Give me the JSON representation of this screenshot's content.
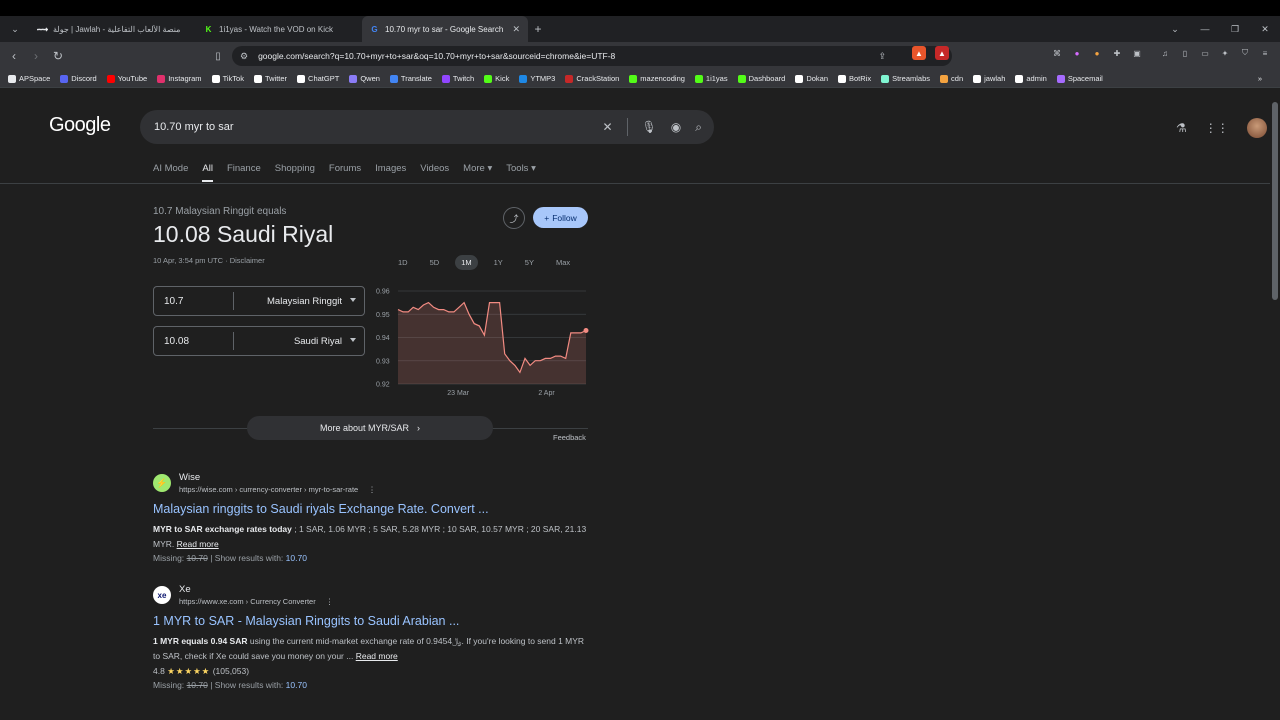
{
  "browser": {
    "tabs": [
      {
        "title": "جولة | Jawlah - منصة الألعاب التفاعلية",
        "icon": "jawlah-icon"
      },
      {
        "title": "1i1yas - Watch the VOD on Kick",
        "icon": "kick-icon"
      },
      {
        "title": "10.70 myr to sar - Google Search",
        "icon": "google-icon",
        "active": true
      }
    ],
    "url": "google.com/search?q=10.70+myr+to+sar&oq=10.70+myr+to+sar&sourceid=chrome&ie=UTF-8",
    "bookmarks": [
      {
        "label": "APSpace",
        "color": "#e8eaed"
      },
      {
        "label": "Discord",
        "color": "#5865f2"
      },
      {
        "label": "YouTube",
        "color": "#ff0000"
      },
      {
        "label": "Instagram",
        "color": "#e1306c"
      },
      {
        "label": "TikTok",
        "color": "#ffffff"
      },
      {
        "label": "Twitter",
        "color": "#ffffff"
      },
      {
        "label": "ChatGPT",
        "color": "#ffffff"
      },
      {
        "label": "Qwen",
        "color": "#8b7cf6"
      },
      {
        "label": "Translate",
        "color": "#4285f4"
      },
      {
        "label": "Twitch",
        "color": "#9146ff"
      },
      {
        "label": "Kick",
        "color": "#53fc18"
      },
      {
        "label": "YTMP3",
        "color": "#1e88e5"
      },
      {
        "label": "CrackStation",
        "color": "#c62828"
      },
      {
        "label": "mazencoding",
        "color": "#53fc18"
      },
      {
        "label": "1i1yas",
        "color": "#53fc18"
      },
      {
        "label": "Dashboard",
        "color": "#53fc18"
      },
      {
        "label": "Dokan",
        "color": "#ffffff"
      },
      {
        "label": "BotRix",
        "color": "#ffffff"
      },
      {
        "label": "Streamlabs",
        "color": "#80f5d2"
      },
      {
        "label": "cdn",
        "color": "#f4a340"
      },
      {
        "label": "jawlah",
        "color": "#ffffff"
      },
      {
        "label": "admin",
        "color": "#ffffff"
      },
      {
        "label": "Spacemail",
        "color": "#a66bff"
      }
    ]
  },
  "google": {
    "logo": "Google",
    "query": "10.70 myr to sar",
    "nav_tabs": [
      "AI Mode",
      "All",
      "Finance",
      "Shopping",
      "Forums",
      "Images",
      "Videos",
      "More",
      "Tools"
    ],
    "active_tab": "All"
  },
  "converter": {
    "equals_text": "10.7 Malaysian Ringgit equals",
    "result": "10.08 Saudi Riyal",
    "timestamp": "10 Apr, 3:54 pm UTC",
    "disclaimer": "Disclaimer",
    "follow": "Follow",
    "from_amount": "10.7",
    "from_currency": "Malaysian Ringgit",
    "to_amount": "10.08",
    "to_currency": "Saudi Riyal",
    "ranges": [
      "1D",
      "5D",
      "1M",
      "1Y",
      "5Y",
      "Max"
    ],
    "selected_range": "1M",
    "more_about": "More about MYR/SAR",
    "feedback": "Feedback"
  },
  "chart_data": {
    "type": "area",
    "title": "",
    "xlabel": "",
    "ylabel": "",
    "x_tick_labels": [
      "23 Mar",
      "2 Apr"
    ],
    "y_tick_labels": [
      "0.96",
      "0.95",
      "0.94",
      "0.93",
      "0.92"
    ],
    "ylim": [
      0.92,
      0.96
    ],
    "grid": true,
    "color": "#f28b82",
    "values": [
      0.952,
      0.951,
      0.951,
      0.953,
      0.952,
      0.954,
      0.955,
      0.953,
      0.952,
      0.952,
      0.951,
      0.951,
      0.953,
      0.955,
      0.95,
      0.946,
      0.945,
      0.941,
      0.955,
      0.955,
      0.955,
      0.933,
      0.93,
      0.928,
      0.925,
      0.931,
      0.928,
      0.93,
      0.93,
      0.931,
      0.931,
      0.932,
      0.932,
      0.931,
      0.942,
      0.942,
      0.942,
      0.943
    ]
  },
  "results": [
    {
      "site": "Wise",
      "url": "https://wise.com › currency-converter › myr-to-sar-rate",
      "title": "Malaysian ringgits to Saudi riyals Exchange Rate. Convert ...",
      "snippet_bold": "MYR to SAR exchange rates today",
      "snippet": " ; 1 SAR, 1.06 MYR ; 5 SAR, 5.28 MYR ; 10 SAR, 10.57 MYR ; 20 SAR, 21.13 MYR.",
      "read_more": "Read more",
      "missing_label": "Missing:",
      "missing_term": "10.70",
      "show_with": "| Show results with:",
      "show_term": "10.70",
      "icon_color": "#9fe870"
    },
    {
      "site": "Xe",
      "url": "https://www.xe.com › Currency Converter",
      "title": "1 MYR to SAR - Malaysian Ringgits to Saudi Arabian ...",
      "snippet_bold": "1 MYR equals 0.94 SAR",
      "snippet": " using the current mid-market exchange rate of 0.9454﷼. If you're looking to send 1 MYR to SAR, check if Xe could save you money on your ...",
      "read_more": "Read more",
      "rating": "4.8",
      "stars": "★★★★★",
      "reviews": "(105,053)",
      "missing_label": "Missing:",
      "missing_term": "10.70",
      "show_with": "| Show results with:",
      "show_term": "10.70",
      "icon_color": "#ffffff"
    }
  ]
}
